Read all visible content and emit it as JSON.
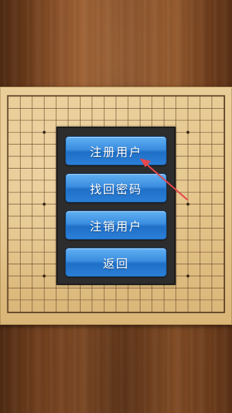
{
  "menu": {
    "register_label": "注册用户",
    "recover_password_label": "找回密码",
    "unregister_label": "注销用户",
    "back_label": "返回"
  },
  "colors": {
    "button_top": "#5fb0f2",
    "button_bottom": "#1f6fc7",
    "board": "#e4c48a",
    "panel": "#2d2d2d",
    "arrow": "#e5484d"
  },
  "icons": {
    "annotation": "red-arrow-icon"
  }
}
